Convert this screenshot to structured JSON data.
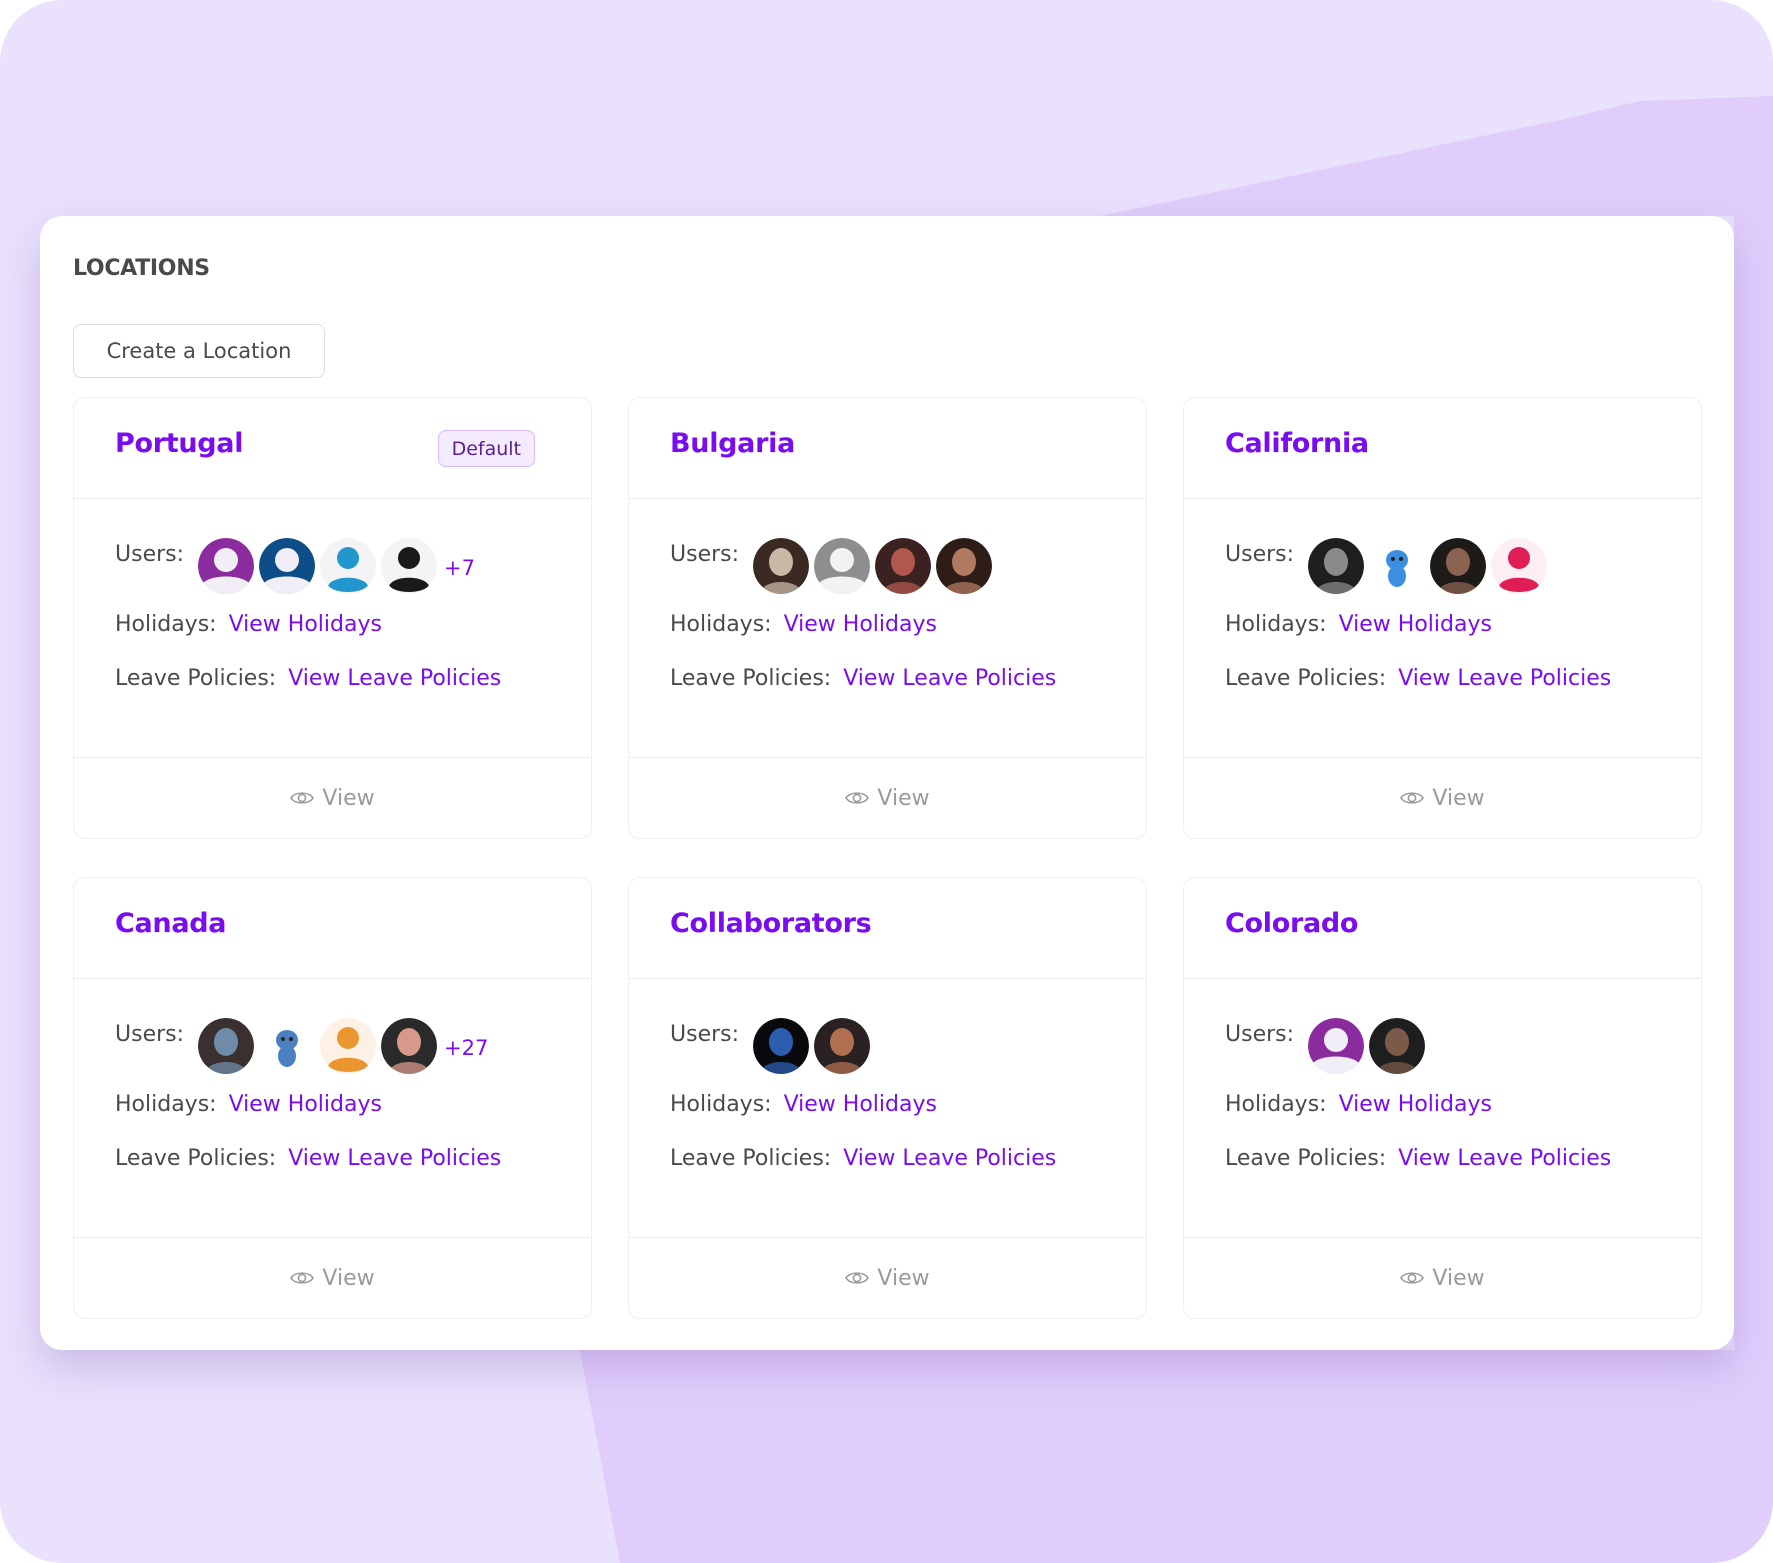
{
  "colors": {
    "accent": "#7A0CF0",
    "bg_light": "#EAE1FD",
    "bg_dark": "#E0CDFC",
    "label": "#4A4A4A",
    "muted": "#9A9A9A"
  },
  "page": {
    "title": "LOCATIONS",
    "create_button": "Create a Location"
  },
  "labels": {
    "users": "Users:",
    "holidays": "Holidays:",
    "leave_policies": "Leave Policies:",
    "view_holidays": "View Holidays",
    "view_leave_policies": "View Leave Policies",
    "view": "View",
    "default_badge": "Default"
  },
  "locations": [
    {
      "name": "Portugal",
      "is_default": true,
      "more_users": "+7",
      "avatars": [
        {
          "kind": "placeholder",
          "fg": "#F2EEF8",
          "bg": "#8A2C9E",
          "invert": true
        },
        {
          "kind": "placeholder",
          "fg": "#F2EEF8",
          "bg": "#0E4E88",
          "invert": true
        },
        {
          "kind": "placeholder",
          "fg": "#2297CE",
          "bg": "#F4F4F6",
          "invert": false
        },
        {
          "kind": "placeholder",
          "fg": "#1A1A1A",
          "bg": "#F4F4F6",
          "invert": false
        }
      ]
    },
    {
      "name": "Bulgaria",
      "is_default": false,
      "more_users": "",
      "avatars": [
        {
          "kind": "photo",
          "tone": "#C9B9A6",
          "dark": "#3A2A22"
        },
        {
          "kind": "placeholder",
          "fg": "#F2F2F2",
          "bg": "#8E8E8E",
          "invert": true
        },
        {
          "kind": "photo",
          "tone": "#B0584E",
          "dark": "#3B2220"
        },
        {
          "kind": "photo",
          "tone": "#B07A60",
          "dark": "#2E1C16"
        }
      ]
    },
    {
      "name": "California",
      "is_default": false,
      "more_users": "",
      "avatars": [
        {
          "kind": "photo",
          "tone": "#8A8A8A",
          "dark": "#1E1E1E"
        },
        {
          "kind": "character",
          "tone": "#3B8FE0",
          "dark": "#FFFFFF"
        },
        {
          "kind": "photo",
          "tone": "#8A6450",
          "dark": "#1E1A18"
        },
        {
          "kind": "placeholder",
          "fg": "#E11D56",
          "bg": "#FCEEF2",
          "invert": false
        }
      ]
    },
    {
      "name": "Canada",
      "is_default": false,
      "more_users": "+27",
      "avatars": [
        {
          "kind": "photo",
          "tone": "#6E8CA8",
          "dark": "#3A3030"
        },
        {
          "kind": "character",
          "tone": "#4C7FC0",
          "dark": "#FFFFFF"
        },
        {
          "kind": "placeholder",
          "fg": "#EA9530",
          "bg": "#FDF1E6",
          "invert": false
        },
        {
          "kind": "photo",
          "tone": "#D79A8A",
          "dark": "#2A2A2A"
        }
      ]
    },
    {
      "name": "Collaborators",
      "is_default": false,
      "more_users": "",
      "avatars": [
        {
          "kind": "photo",
          "tone": "#2C5EB0",
          "dark": "#0A0A0E"
        },
        {
          "kind": "photo",
          "tone": "#B07050",
          "dark": "#2A2222"
        }
      ]
    },
    {
      "name": "Colorado",
      "is_default": false,
      "more_users": "",
      "avatars": [
        {
          "kind": "placeholder",
          "fg": "#F2EEF8",
          "bg": "#8A2C9E",
          "invert": true
        },
        {
          "kind": "photo",
          "tone": "#7A5A48",
          "dark": "#1E1E1E"
        }
      ]
    }
  ]
}
